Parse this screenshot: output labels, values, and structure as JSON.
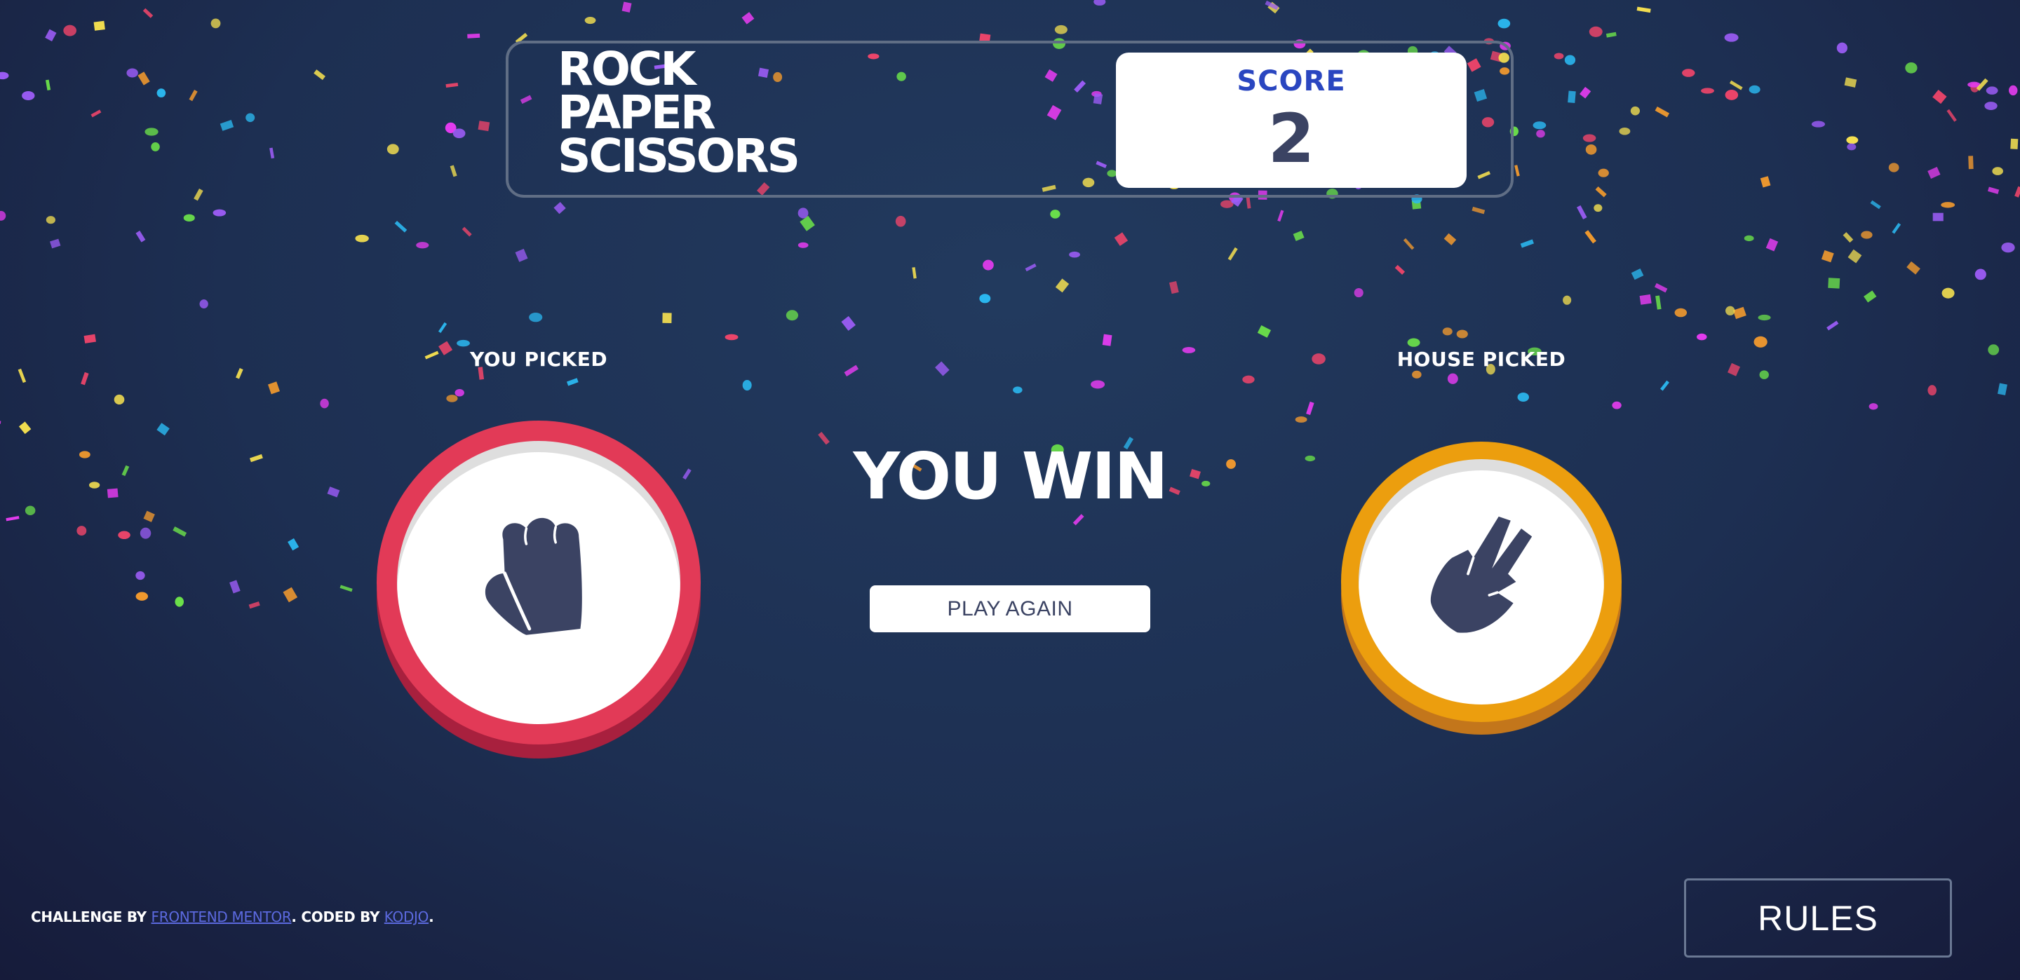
{
  "header": {
    "title_lines": [
      "ROCK",
      "PAPER",
      "SCISSORS"
    ],
    "score_label": "SCORE",
    "score_value": "2"
  },
  "game": {
    "you_picked_label": "YOU PICKED",
    "house_picked_label": "HOUSE PICKED",
    "you_choice": "rock",
    "house_choice": "scissors",
    "result_text": "YOU WIN",
    "play_again_label": "PLAY AGAIN"
  },
  "footer": {
    "prefix": "CHALLENGE BY ",
    "link1": "FRONTEND MENTOR",
    "middle": ". CODED BY ",
    "link2": "KODJO",
    "suffix": "."
  },
  "rules_label": "RULES",
  "colors": {
    "background": "#1f3756",
    "rock_ring": "#e23a57",
    "scissors_ring": "#ec9e0e",
    "score_label": "#2a46c0",
    "icon_dark": "#3b4363",
    "link": "#5c6ae0"
  },
  "confetti_colors": [
    "#e53cf0",
    "#f5e050",
    "#2bb8f0",
    "#9b5cf5",
    "#f29a2e",
    "#6be04a",
    "#f0456a"
  ]
}
